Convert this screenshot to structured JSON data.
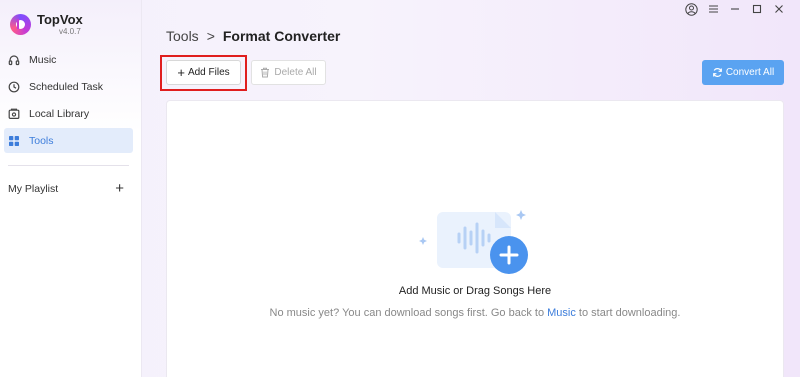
{
  "app": {
    "name": "TopVox",
    "version": "v4.0.7"
  },
  "sidebar": {
    "items": [
      {
        "label": "Music",
        "icon": "headphones-icon"
      },
      {
        "label": "Scheduled Task",
        "icon": "clock-icon"
      },
      {
        "label": "Local Library",
        "icon": "library-icon"
      },
      {
        "label": "Tools",
        "icon": "tools-grid-icon",
        "active": true
      }
    ],
    "playlist_label": "My Playlist",
    "playlist_add": "+"
  },
  "breadcrumb": {
    "root": "Tools",
    "separator": ">",
    "current": "Format Converter"
  },
  "toolbar": {
    "add_plus": "+",
    "add_label": "Add Files",
    "delete_label": "Delete All",
    "convert_label": "Convert All"
  },
  "empty_state": {
    "title": "Add Music or Drag Songs Here",
    "hint_before": "No music yet? You can download songs first. Go back to ",
    "hint_link": "Music",
    "hint_after": " to start downloading."
  },
  "colors": {
    "accent": "#3c7ddb",
    "convert_button": "#5aa3f1",
    "highlight_box": "#e01e1e",
    "active_nav_bg": "#e3ecfb"
  }
}
